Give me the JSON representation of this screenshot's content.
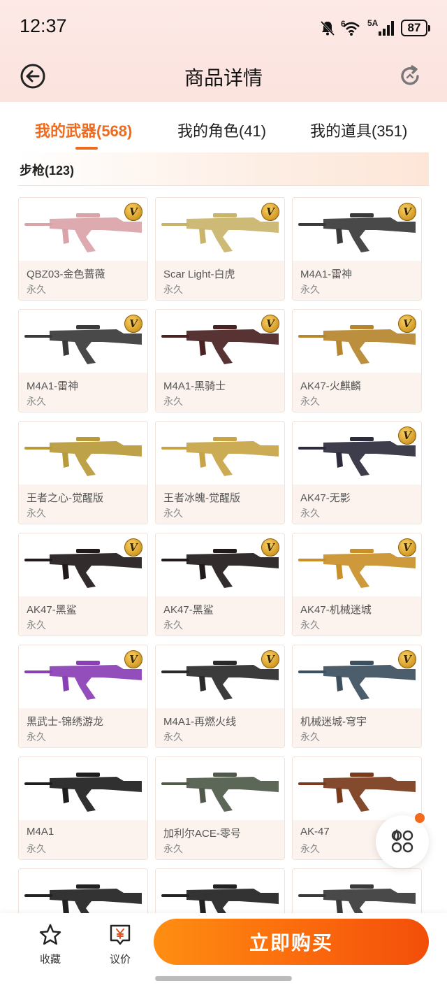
{
  "status_bar": {
    "time": "12:37",
    "network": "5A",
    "wifi_badge": "6",
    "battery": "87"
  },
  "nav": {
    "title": "商品详情",
    "back_icon": "back-arrow-circle-icon",
    "refresh_icon": "refresh-icon"
  },
  "tabs": [
    {
      "label": "我的武器(568)",
      "active": true
    },
    {
      "label": "我的角色(41)",
      "active": false
    },
    {
      "label": "我的道具(351)",
      "active": false
    }
  ],
  "section": {
    "label": "步枪(123)"
  },
  "items": [
    {
      "name": "QBZ03-金色蔷薇",
      "duration": "永久",
      "badge": "V",
      "color": "#d9a3a8"
    },
    {
      "name": "Scar Light-白虎",
      "duration": "永久",
      "badge": "V",
      "color": "#c9b46a"
    },
    {
      "name": "M4A1-雷神",
      "duration": "永久",
      "badge": "V",
      "color": "#3a3a3a"
    },
    {
      "name": "M4A1-雷神",
      "duration": "永久",
      "badge": "V",
      "color": "#3a3a3a"
    },
    {
      "name": "M4A1-黑骑士",
      "duration": "永久",
      "badge": "V",
      "color": "#4a2222"
    },
    {
      "name": "AK47-火麒麟",
      "duration": "永久",
      "badge": "V",
      "color": "#b5862e"
    },
    {
      "name": "王者之心-觉醒版",
      "duration": "永久",
      "badge": "",
      "color": "#b89a3a"
    },
    {
      "name": "王者冰魄-觉醒版",
      "duration": "永久",
      "badge": "",
      "color": "#c7a445"
    },
    {
      "name": "AK47-无影",
      "duration": "永久",
      "badge": "V",
      "color": "#2c2c3c"
    },
    {
      "name": "AK47-黑鲨",
      "duration": "永久",
      "badge": "V",
      "color": "#221a1a"
    },
    {
      "name": "AK47-黑鲨",
      "duration": "永久",
      "badge": "V",
      "color": "#221a1a"
    },
    {
      "name": "AK47-机械迷城",
      "duration": "永久",
      "badge": "V",
      "color": "#c9902a"
    },
    {
      "name": "黑武士-锦绣游龙",
      "duration": "永久",
      "badge": "V",
      "color": "#8a3fb5"
    },
    {
      "name": "M4A1-再燃火线",
      "duration": "永久",
      "badge": "V",
      "color": "#2a2a2a"
    },
    {
      "name": "机械迷城-穹宇",
      "duration": "永久",
      "badge": "V",
      "color": "#3d5060"
    },
    {
      "name": "M4A1",
      "duration": "永久",
      "badge": "",
      "color": "#1e1e1e"
    },
    {
      "name": "加利尔ACE-零号",
      "duration": "永久",
      "badge": "",
      "color": "#4f5a4a"
    },
    {
      "name": "AK-47",
      "duration": "永久",
      "badge": "",
      "color": "#7a3b1c"
    },
    {
      "name": "",
      "duration": "",
      "badge": "",
      "color": "#222222"
    },
    {
      "name": "",
      "duration": "",
      "badge": "",
      "color": "#222222"
    },
    {
      "name": "",
      "duration": "",
      "badge": "",
      "color": "#3a3a3a"
    }
  ],
  "float_button": {
    "icon": "apps-grid-icon"
  },
  "bottom_bar": {
    "favorite_label": "收藏",
    "bargain_label": "议价",
    "buy_label": "立即购买"
  },
  "colors": {
    "accent": "#ef6a1c",
    "buy_gradient_start": "#fe8e12",
    "buy_gradient_end": "#f24e0a"
  }
}
